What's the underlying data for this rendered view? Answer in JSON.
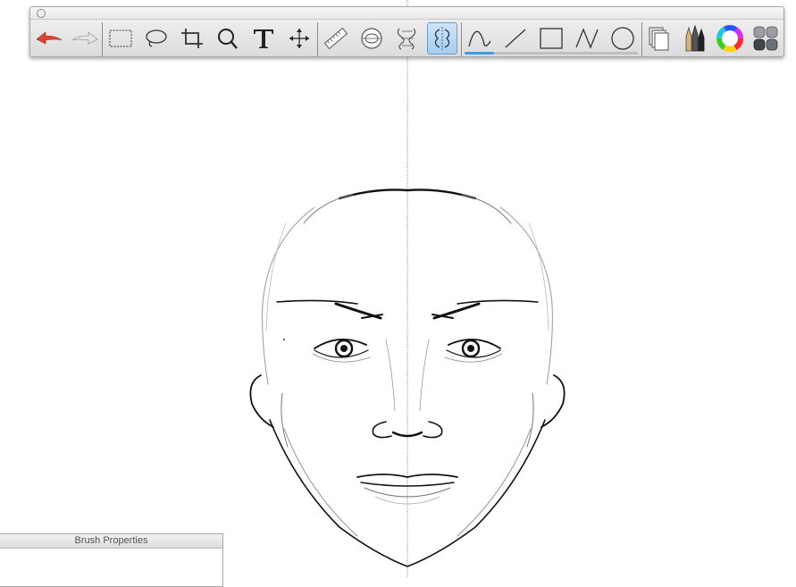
{
  "app": {
    "toolbar": {
      "tools": [
        {
          "id": "undo",
          "icon": "undo-arrow-icon"
        },
        {
          "id": "redo",
          "icon": "redo-arrow-icon"
        },
        {
          "id": "rect-select",
          "icon": "rectangle-select-icon"
        },
        {
          "id": "lasso",
          "icon": "lasso-icon"
        },
        {
          "id": "crop",
          "icon": "crop-icon"
        },
        {
          "id": "zoom",
          "icon": "magnifier-icon"
        },
        {
          "id": "text",
          "icon": "text-tool-icon"
        },
        {
          "id": "move",
          "icon": "move-arrows-icon"
        },
        {
          "id": "ruler",
          "icon": "ruler-icon"
        },
        {
          "id": "ellipse-guide",
          "icon": "ellipse-guide-icon"
        },
        {
          "id": "french-curve",
          "icon": "french-curve-icon"
        },
        {
          "id": "symmetry",
          "icon": "symmetry-icon",
          "active": true
        },
        {
          "id": "freehand-stroke",
          "icon": "freehand-stroke-icon"
        },
        {
          "id": "line-stroke",
          "icon": "line-stroke-icon"
        },
        {
          "id": "rect-stroke",
          "icon": "rectangle-stroke-icon"
        },
        {
          "id": "polyline-stroke",
          "icon": "polyline-stroke-icon"
        },
        {
          "id": "circle-stroke",
          "icon": "circle-stroke-icon"
        },
        {
          "id": "layers",
          "icon": "layers-icon"
        },
        {
          "id": "brushes",
          "icon": "brush-pencils-icon"
        },
        {
          "id": "colors",
          "icon": "color-wheel-icon"
        },
        {
          "id": "palette",
          "icon": "palette-grid-icon"
        }
      ],
      "stroke_smoothing_level": 0.17,
      "colors": {
        "undo": "#d9432f",
        "active_tool_bg": "#b8d6f0",
        "slider_fill": "#3f9be8"
      }
    },
    "brush_panel": {
      "title": "Brush Properties"
    },
    "symmetry_axis_color": "#9a9a9a"
  }
}
